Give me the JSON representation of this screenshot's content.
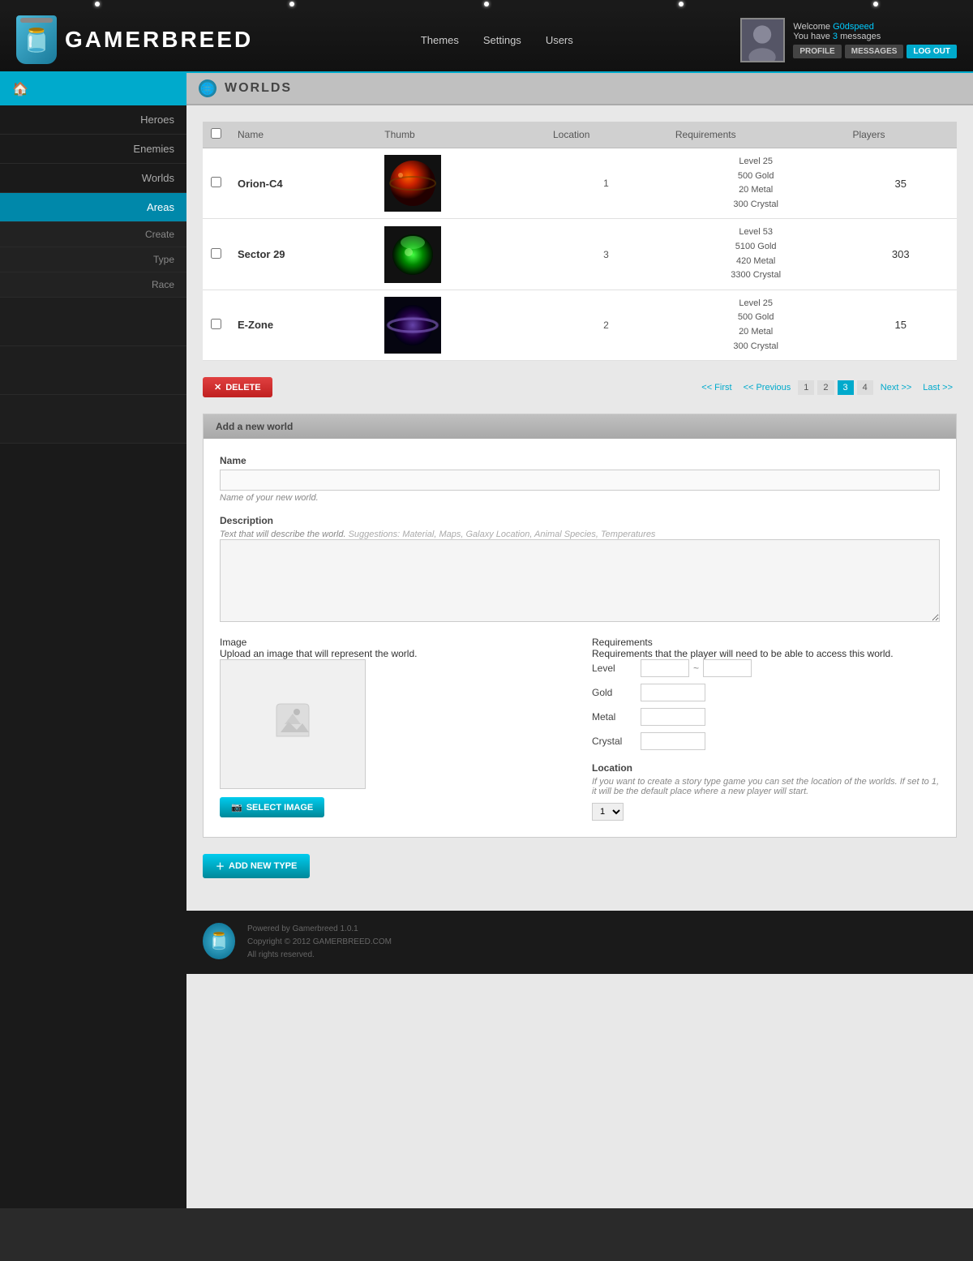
{
  "header": {
    "logo_text": "GAMERBREED",
    "nav": [
      {
        "label": "Themes"
      },
      {
        "label": "Settings"
      },
      {
        "label": "Users"
      }
    ],
    "user": {
      "welcome": "Welcome ",
      "username": "G0dspeed",
      "messages_pre": "You have ",
      "messages_count": "3",
      "messages_post": " messages",
      "profile_btn": "PROFILE",
      "messages_btn": "MESSAGES",
      "logout_btn": "LOG OUT"
    }
  },
  "sidebar": {
    "items": [
      {
        "label": "Heroes",
        "active": false
      },
      {
        "label": "Enemies",
        "active": false
      },
      {
        "label": "Worlds",
        "active": false
      },
      {
        "label": "Areas",
        "active": true
      }
    ],
    "sub_items": [
      {
        "label": "Create"
      },
      {
        "label": "Type"
      },
      {
        "label": "Race"
      }
    ]
  },
  "page": {
    "title": "WORLDS"
  },
  "table": {
    "columns": [
      "Name",
      "Thumb",
      "Location",
      "Requirements",
      "Players"
    ],
    "rows": [
      {
        "name": "Orion-C4",
        "location": "1",
        "requirements": [
          "Level 25",
          "500 Gold",
          "20 Metal",
          "300 Crystal"
        ],
        "players": "35",
        "planet_type": "orion"
      },
      {
        "name": "Sector 29",
        "location": "3",
        "requirements": [
          "Level 53",
          "5100 Gold",
          "420 Metal",
          "3300 Crystal"
        ],
        "players": "303",
        "planet_type": "sector"
      },
      {
        "name": "E-Zone",
        "location": "2",
        "requirements": [
          "Level 25",
          "500 Gold",
          "20 Metal",
          "300 Crystal"
        ],
        "players": "15",
        "planet_type": "ezone"
      }
    ]
  },
  "pagination": {
    "first": "<< First",
    "prev": "<< Previous",
    "pages": [
      "1",
      "2",
      "3",
      "4"
    ],
    "active_page": "3",
    "next": "Next >>",
    "last": "Last >>"
  },
  "delete_btn": "DELETE",
  "add_world_form": {
    "section_title": "Add a new world",
    "name_label": "Name",
    "name_placeholder": "",
    "name_hint": "Name of your new world.",
    "desc_label": "Description",
    "desc_hint": "Text that will describe the world.",
    "desc_placeholder": "Suggestions: Material, Maps, Galaxy Location, Animal Species, Temperatures",
    "image_label": "Image",
    "image_hint": "Upload an image that will represent the world.",
    "select_image_btn": "SELECT IMAGE",
    "req_label": "Requirements",
    "req_hint": "Requirements that the player will need to be able to access this world.",
    "level_label": "Level",
    "gold_label": "Gold",
    "metal_label": "Metal",
    "crystal_label": "Crystal",
    "location_label": "Location",
    "location_hint": "If you want to create a story type game you can set the location of the worlds. If set to 1, it will be the default place where a new player will start.",
    "location_value": "1"
  },
  "add_type_btn": "ADD NEW TYPE",
  "footer": {
    "powered_by": "Powered by Gamerbreed 1.0.1",
    "copyright": "Copyright © 2012 GAMERBREED.COM",
    "rights": "All rights reserved."
  }
}
